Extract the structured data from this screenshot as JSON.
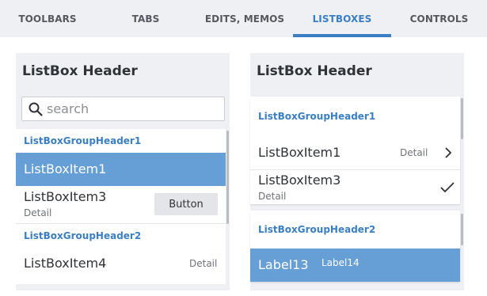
{
  "tabs": [
    {
      "label": "TOOLBARS"
    },
    {
      "label": "TABS"
    },
    {
      "label": "EDITS, MEMOS"
    },
    {
      "label": "LISTBOXES"
    },
    {
      "label": "CONTROLS"
    }
  ],
  "active_tab_index": 3,
  "colors": {
    "accent": "#3a7fc4",
    "selected_row": "#669fd6",
    "panel_bg": "#eef0f3"
  },
  "left": {
    "header": "ListBox Header",
    "search": {
      "placeholder": "search",
      "value": ""
    },
    "group1": "ListBoxGroupHeader1",
    "item1": {
      "title": "ListBoxItem1"
    },
    "item3": {
      "title": "ListBoxItem3",
      "detail": "Detail",
      "button": "Button"
    },
    "group2": "ListBoxGroupHeader2",
    "item4": {
      "title": "ListBoxItem4",
      "detail": "Detail"
    }
  },
  "right": {
    "header": "ListBox Header",
    "group1": "ListBoxGroupHeader1",
    "item1": {
      "title": "ListBoxItem1",
      "detail": "Detail",
      "accessory": "chevron-right-icon"
    },
    "item3": {
      "title": "ListBoxItem3",
      "detail": "Detail",
      "accessory": "checkmark-icon"
    },
    "group2": "ListBoxGroupHeader2",
    "label13": "Label13",
    "label14": "Label14"
  }
}
